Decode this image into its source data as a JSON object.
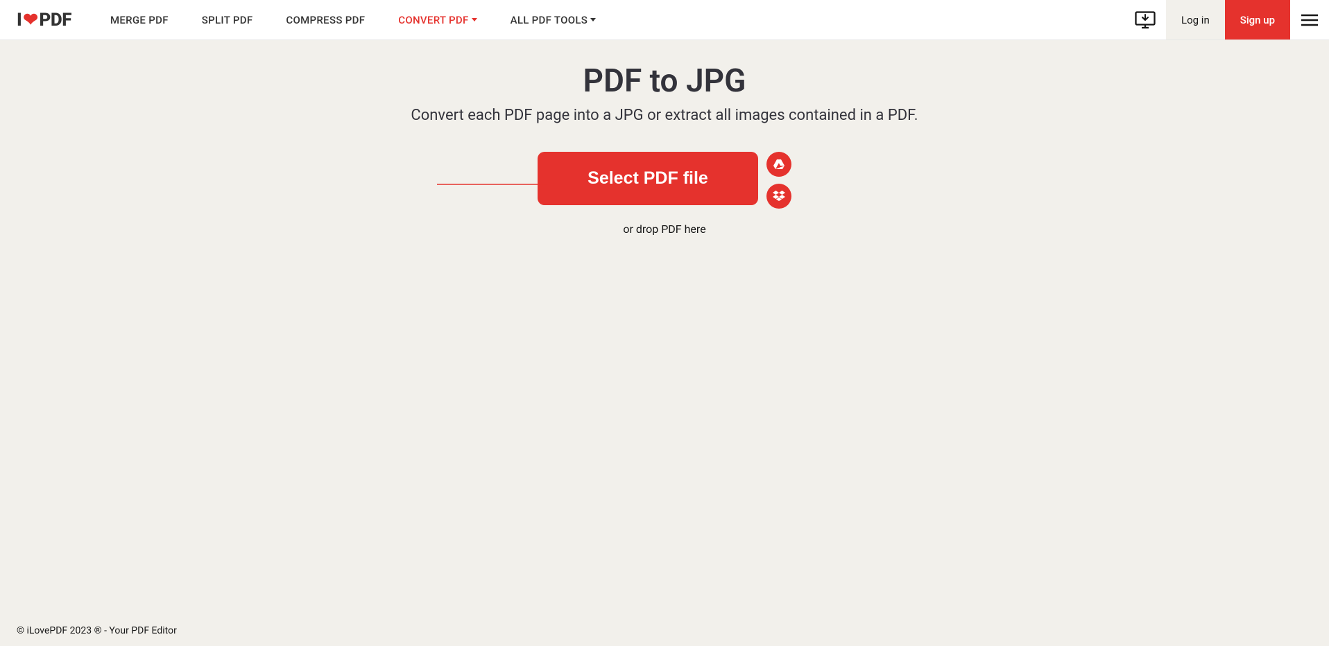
{
  "brand": {
    "prefix": "I",
    "suffix": "PDF"
  },
  "nav": {
    "items": [
      {
        "label": "MERGE PDF",
        "dropdown": false,
        "active": false
      },
      {
        "label": "SPLIT PDF",
        "dropdown": false,
        "active": false
      },
      {
        "label": "COMPRESS PDF",
        "dropdown": false,
        "active": false
      },
      {
        "label": "CONVERT PDF",
        "dropdown": true,
        "active": true
      },
      {
        "label": "ALL PDF TOOLS",
        "dropdown": true,
        "active": false
      }
    ]
  },
  "header_right": {
    "login_label": "Log in",
    "signup_label": "Sign up"
  },
  "page": {
    "title": "PDF to JPG",
    "subtitle": "Convert each PDF page into a JPG or extract all images contained in a PDF.",
    "select_button": "Select PDF file",
    "drop_text": "or drop PDF here"
  },
  "cloud_sources": {
    "google_drive": "google-drive",
    "dropbox": "dropbox"
  },
  "footer": {
    "text": "© iLovePDF 2023 ® - Your PDF Editor"
  },
  "colors": {
    "accent": "#e5322d",
    "background": "#f2f0eb",
    "text_dark": "#33333b"
  }
}
